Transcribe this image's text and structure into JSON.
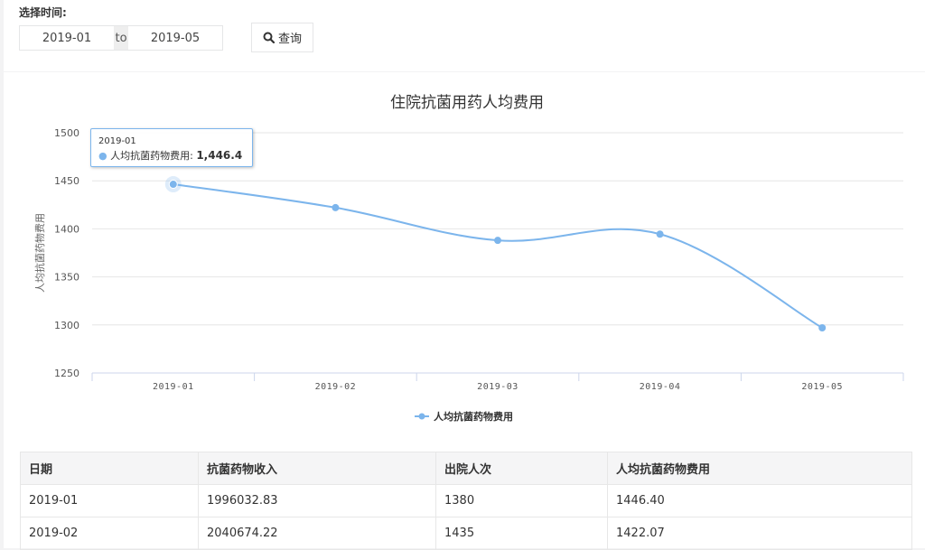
{
  "filter": {
    "label": "选择时间:",
    "start": "2019-01",
    "to": "to",
    "end": "2019-05",
    "query_label": "查询"
  },
  "chart_data": {
    "type": "line",
    "title": "住院抗菌用药人均费用",
    "xlabel": "",
    "ylabel": "人均抗菌药物费用",
    "categories": [
      "2019-01",
      "2019-02",
      "2019-03",
      "2019-04",
      "2019-05"
    ],
    "series": [
      {
        "name": "人均抗菌药物费用",
        "values": [
          1446.4,
          1422.07,
          1388.0,
          1394.5,
          1297.0
        ],
        "color": "#7cb5ec"
      }
    ],
    "ylim": [
      1250,
      1500
    ],
    "yticks": [
      1250,
      1300,
      1350,
      1400,
      1450,
      1500
    ],
    "grid": true,
    "legend": "bottom-center"
  },
  "tooltip": {
    "date": "2019-01",
    "label": "人均抗菌药物费用:",
    "value": "1,446.4"
  },
  "table": {
    "headers": [
      "日期",
      "抗菌药物收入",
      "出院人次",
      "人均抗菌药物费用"
    ],
    "rows": [
      [
        "2019-01",
        "1996032.83",
        "1380",
        "1446.40"
      ],
      [
        "2019-02",
        "2040674.22",
        "1435",
        "1422.07"
      ]
    ]
  }
}
